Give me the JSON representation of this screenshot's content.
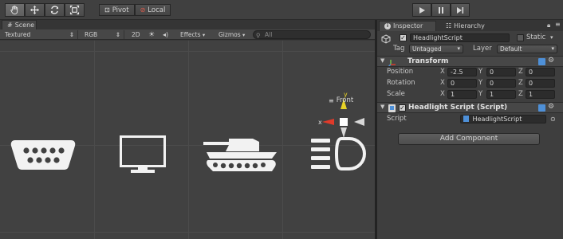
{
  "toolbar": {
    "pivot_label": "Pivot",
    "local_label": "Local"
  },
  "scene": {
    "tab_label": "Scene",
    "shading_mode": "Textured",
    "render_mode": "RGB",
    "mode_2d": "2D",
    "effects_label": "Effects",
    "gizmos_label": "Gizmos",
    "search_placeholder": "All",
    "gizmo_y": "y",
    "gizmo_x": "x",
    "gizmo_view": "Front"
  },
  "inspector": {
    "tab_inspector": "Inspector",
    "tab_hierarchy": "Hierarchy",
    "object_name": "HeadlightScript",
    "static_label": "Static",
    "tag_label": "Tag",
    "tag_value": "Untagged",
    "layer_label": "Layer",
    "layer_value": "Default",
    "transform": {
      "title": "Transform",
      "position_label": "Position",
      "rotation_label": "Rotation",
      "scale_label": "Scale",
      "axis_x": "X",
      "axis_y": "Y",
      "axis_z": "Z",
      "position": {
        "x": "-2.5",
        "y": "0",
        "z": "0"
      },
      "rotation": {
        "x": "0",
        "y": "0",
        "z": "0"
      },
      "scale": {
        "x": "1",
        "y": "1",
        "z": "1"
      }
    },
    "script_component": {
      "title": "Headlight Script (Script)",
      "script_label": "Script",
      "script_value": "HeadlightScript"
    },
    "add_component": "Add Component"
  },
  "colors": {
    "gizmo_red": "#e03a2a",
    "gizmo_yellow": "#e8d326",
    "icon_white": "#f2f2f2",
    "transform_blue": "#4e90d8"
  }
}
